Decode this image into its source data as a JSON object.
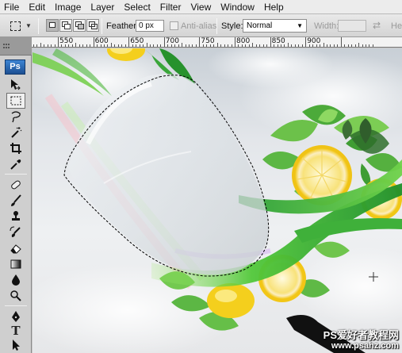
{
  "menu": [
    "File",
    "Edit",
    "Image",
    "Layer",
    "Select",
    "Filter",
    "View",
    "Window",
    "Help"
  ],
  "options": {
    "feather_label": "Feather:",
    "feather_value": "0 px",
    "antialias_label": "Anti-alias",
    "style_label": "Style:",
    "style_value": "Normal",
    "width_label": "Width:",
    "height_label": "He"
  },
  "ruler": {
    "labels": [
      "550",
      "600",
      "650",
      "700",
      "750",
      "800",
      "850",
      "900"
    ]
  },
  "tools": {
    "logo": "Ps"
  },
  "watermark": {
    "line1": "PS爱好者教程网",
    "line2": "www.psahz.com"
  },
  "colors": {
    "menubar_bg": "#ececec",
    "panel_bg": "#cfcfcf",
    "ps_logo": "#2a66b3",
    "leaf_green": "#3fb03a",
    "lemon": "#f6d21a"
  },
  "icons": [
    "rect-marquee-icon",
    "move-icon",
    "lasso-icon",
    "magic-wand-icon",
    "crop-icon",
    "eyedropper-icon",
    "healing-brush-icon",
    "brush-icon",
    "clone-stamp-icon",
    "history-brush-icon",
    "eraser-icon",
    "gradient-icon",
    "blur-icon",
    "dodge-icon",
    "pen-icon",
    "type-icon",
    "path-selection-icon"
  ]
}
